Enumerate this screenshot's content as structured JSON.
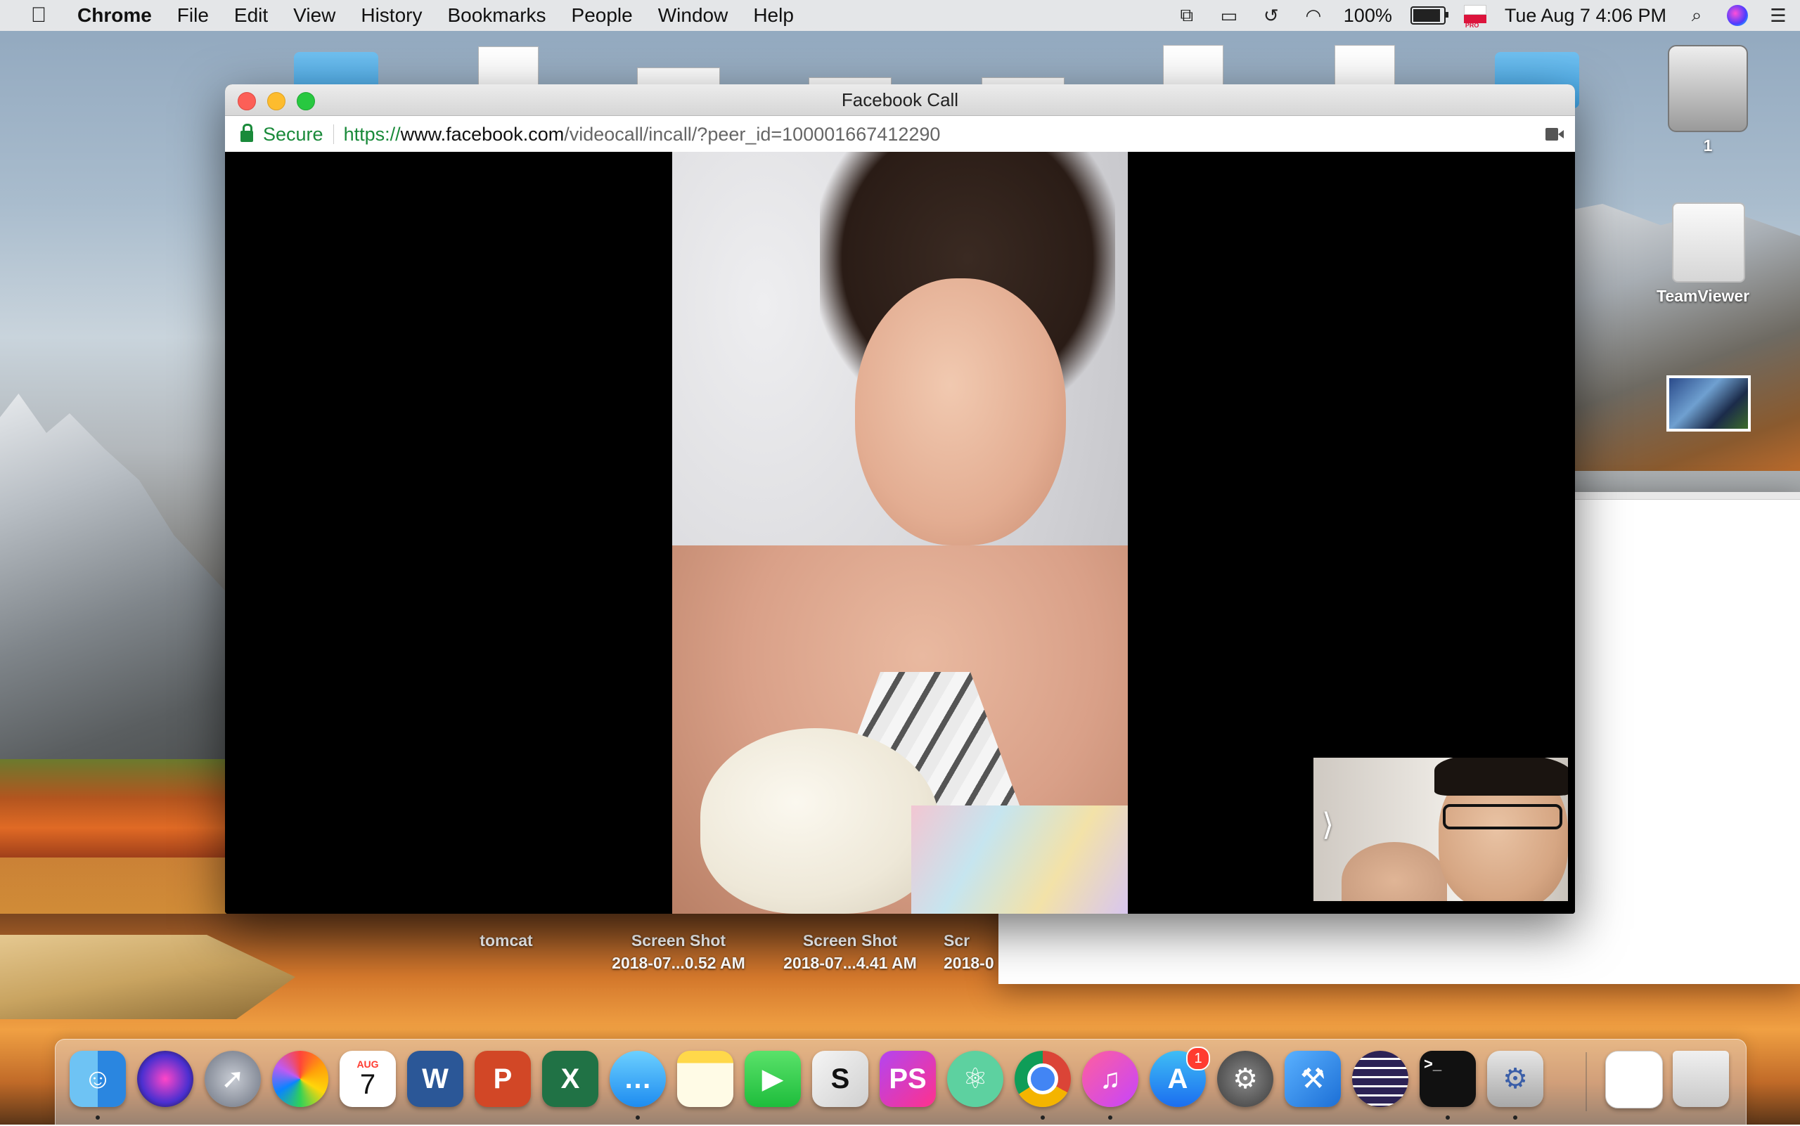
{
  "menubar": {
    "app_name": "Chrome",
    "menus": [
      "File",
      "Edit",
      "View",
      "History",
      "Bookmarks",
      "People",
      "Window",
      "Help"
    ],
    "battery_percent": "100%",
    "battery_level": 1.0,
    "date_time": "Tue Aug 7  4:06 PM",
    "input_flag_label": "PRO"
  },
  "window": {
    "title": "Facebook Call",
    "address": {
      "security_label": "Secure",
      "url_scheme": "https://",
      "url_host": "www.facebook.com",
      "url_path": "/videocall/incall/?peer_id=100001667412290"
    }
  },
  "desktop_icons": {
    "hdd_label": "1",
    "teamviewer_label": "TeamViewer"
  },
  "files": [
    {
      "name": "tomcat",
      "detail": ""
    },
    {
      "name": "Screen Shot",
      "detail": "2018-07...0.52 AM"
    },
    {
      "name": "Screen Shot",
      "detail": "2018-07...4.41 AM"
    },
    {
      "name": "Scr",
      "detail": "2018-0"
    }
  ],
  "dock": {
    "calendar_month": "AUG",
    "calendar_day": "7",
    "app_store_badge": "1"
  },
  "colors": {
    "secure_green": "#1a8a3a",
    "close": "#fc5f57",
    "minimize": "#fdbc2e",
    "maximize": "#28c840",
    "badge": "#ff3b30"
  }
}
